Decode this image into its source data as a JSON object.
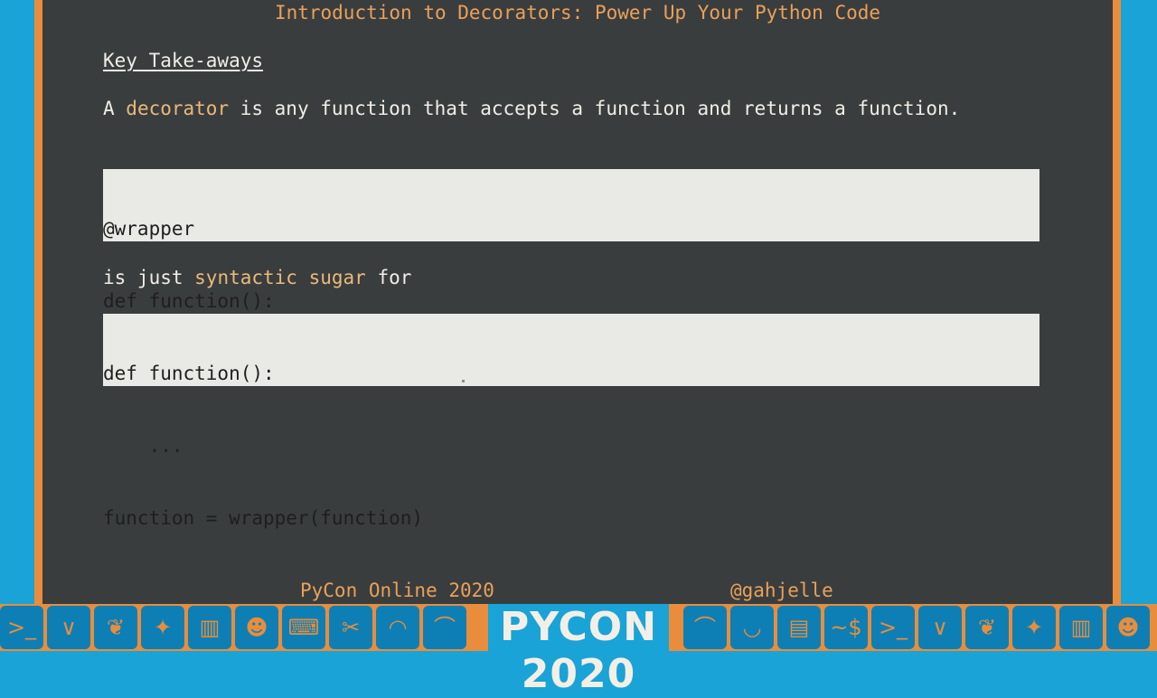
{
  "slide": {
    "title": "Introduction to Decorators: Power Up Your Python Code",
    "heading": "Key Take-aways",
    "statement": {
      "prefix": "A ",
      "term": "decorator",
      "suffix": " is any function that accepts a function and returns a function."
    },
    "code_block_1": [
      "@wrapper",
      "def function():",
      "    ..."
    ],
    "connector": {
      "prefix": "is just ",
      "term": "syntactic sugar",
      "suffix": " for"
    },
    "code_block_2": [
      "def function():",
      "    ...",
      "function = wrapper(function)"
    ]
  },
  "footer": {
    "event": "PyCon Online 2020",
    "handle": "@gahjelle"
  },
  "banner": {
    "logo_text": "PYCON 2020",
    "icons": [
      "terminal-icon",
      "snake-icon",
      "chevron-icon",
      "leaf-icon",
      "compass-icon",
      "building-icon",
      "robot-icon",
      "keyboard-icon",
      "tools-icon",
      "wave-icon",
      "bridge-icon",
      "terminal-icon",
      "bridge-icon",
      "browser-icon",
      "prompt-icon",
      "terminal-icon",
      "snake-icon",
      "chevron-icon",
      "leaf-icon",
      "compass-icon",
      "building-icon",
      "robot-icon"
    ]
  },
  "colors": {
    "background": "#1aa3d6",
    "terminal": "#3a3d3e",
    "accent_orange": "#e98d3c",
    "title_text": "#e9a15a",
    "highlight_text": "#eab97b",
    "code_bg": "#e9eae5"
  }
}
